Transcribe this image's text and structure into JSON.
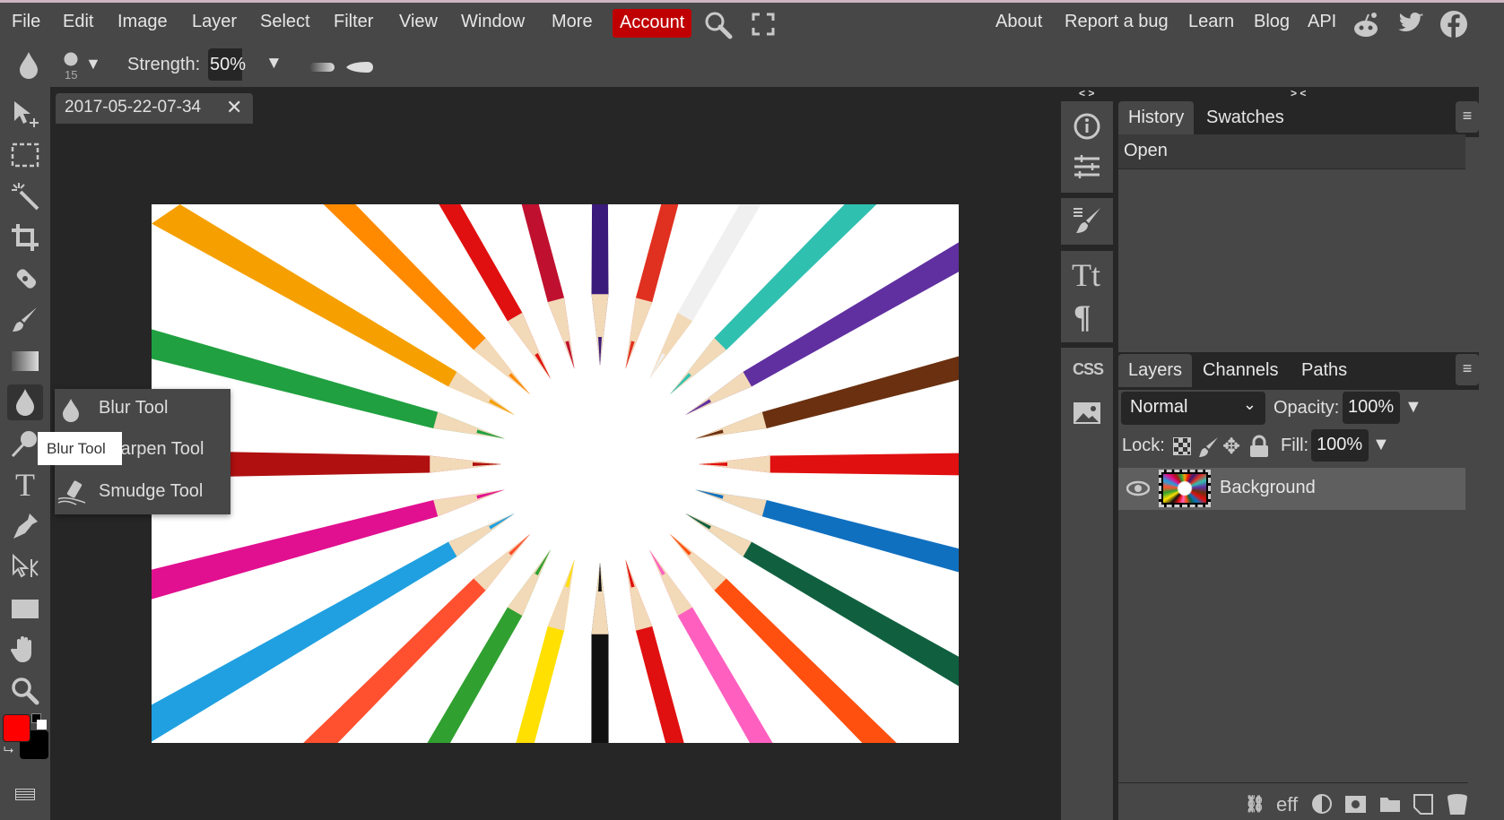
{
  "menu": {
    "items": [
      "File",
      "Edit",
      "Image",
      "Layer",
      "Select",
      "Filter",
      "View",
      "Window",
      "More"
    ],
    "account": "Account",
    "right_links": [
      "About",
      "Report a bug",
      "Learn",
      "Blog",
      "API"
    ],
    "accent": "#c00000"
  },
  "options": {
    "brush_size": "15",
    "strength_label": "Strength:",
    "strength_value": "50%"
  },
  "document": {
    "tab_title": "2017-05-22-07-34"
  },
  "flyout": {
    "items": [
      "Blur Tool",
      "Sharpen Tool",
      "Smudge Tool"
    ],
    "sharpen_visible": "arpen Tool"
  },
  "tooltip": "Blur Tool",
  "colors": {
    "foreground": "#ff0000",
    "background": "#000000"
  },
  "history": {
    "tabs": [
      "History",
      "Swatches"
    ],
    "items": [
      "Open"
    ],
    "collapse_left": "< >",
    "collapse_right": "> <"
  },
  "layers": {
    "tabs": [
      "Layers",
      "Channels",
      "Paths"
    ],
    "blend_mode": "Normal",
    "opacity_label": "Opacity:",
    "opacity": "100%",
    "lock_label": "Lock:",
    "fill_label": "Fill:",
    "fill": "100%",
    "items": [
      {
        "name": "Background",
        "visible": true
      }
    ]
  },
  "side_icons": {
    "css": "CSS"
  },
  "bottom_icons": [
    "link-icon",
    "effects-icon",
    "adjustment-icon",
    "mask-icon",
    "folder-icon",
    "new-layer-icon",
    "trash-icon"
  ],
  "bottom_eff": "eff"
}
